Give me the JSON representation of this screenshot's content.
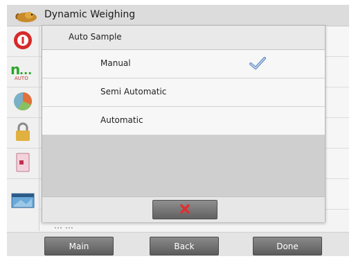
{
  "app": {
    "title": "Dynamic Weighing"
  },
  "sidebar": {
    "items": [
      {
        "icon": "info-icon"
      },
      {
        "icon": "application-mode-icon",
        "sub_label": "AUTO"
      },
      {
        "icon": "calibration-icon"
      },
      {
        "icon": "lock-icon"
      },
      {
        "icon": "report-icon"
      },
      {
        "icon": "display-icon"
      }
    ]
  },
  "background_rows": [
    {
      "label": ""
    },
    {
      "label": ""
    },
    {
      "label": ""
    },
    {
      "label": ""
    },
    {
      "label": ""
    },
    {
      "label": "…   …"
    }
  ],
  "dialog": {
    "title": "Auto Sample",
    "options": [
      {
        "label": "Manual",
        "selected": true
      },
      {
        "label": "Semi Automatic",
        "selected": false
      },
      {
        "label": "Automatic",
        "selected": false
      }
    ],
    "cancel_icon": "x-icon"
  },
  "bottom_nav": {
    "main_label": "Main",
    "back_label": "Back",
    "done_label": "Done"
  },
  "colors": {
    "cancel_x": "#e03030",
    "checkmark": "#6a8fc8",
    "header": "#dcdcdc"
  }
}
